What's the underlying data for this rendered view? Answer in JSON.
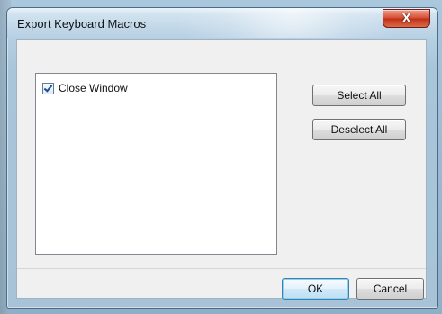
{
  "window": {
    "title": "Export Keyboard Macros",
    "close_symbol": "X"
  },
  "macros": {
    "items": [
      {
        "label": "Close Window",
        "checked": true
      }
    ]
  },
  "buttons": {
    "select_all": "Select All",
    "deselect_all": "Deselect All",
    "ok": "OK",
    "cancel": "Cancel"
  },
  "icons": {
    "close": "close-icon",
    "checkbox": "checkbox-icon"
  }
}
